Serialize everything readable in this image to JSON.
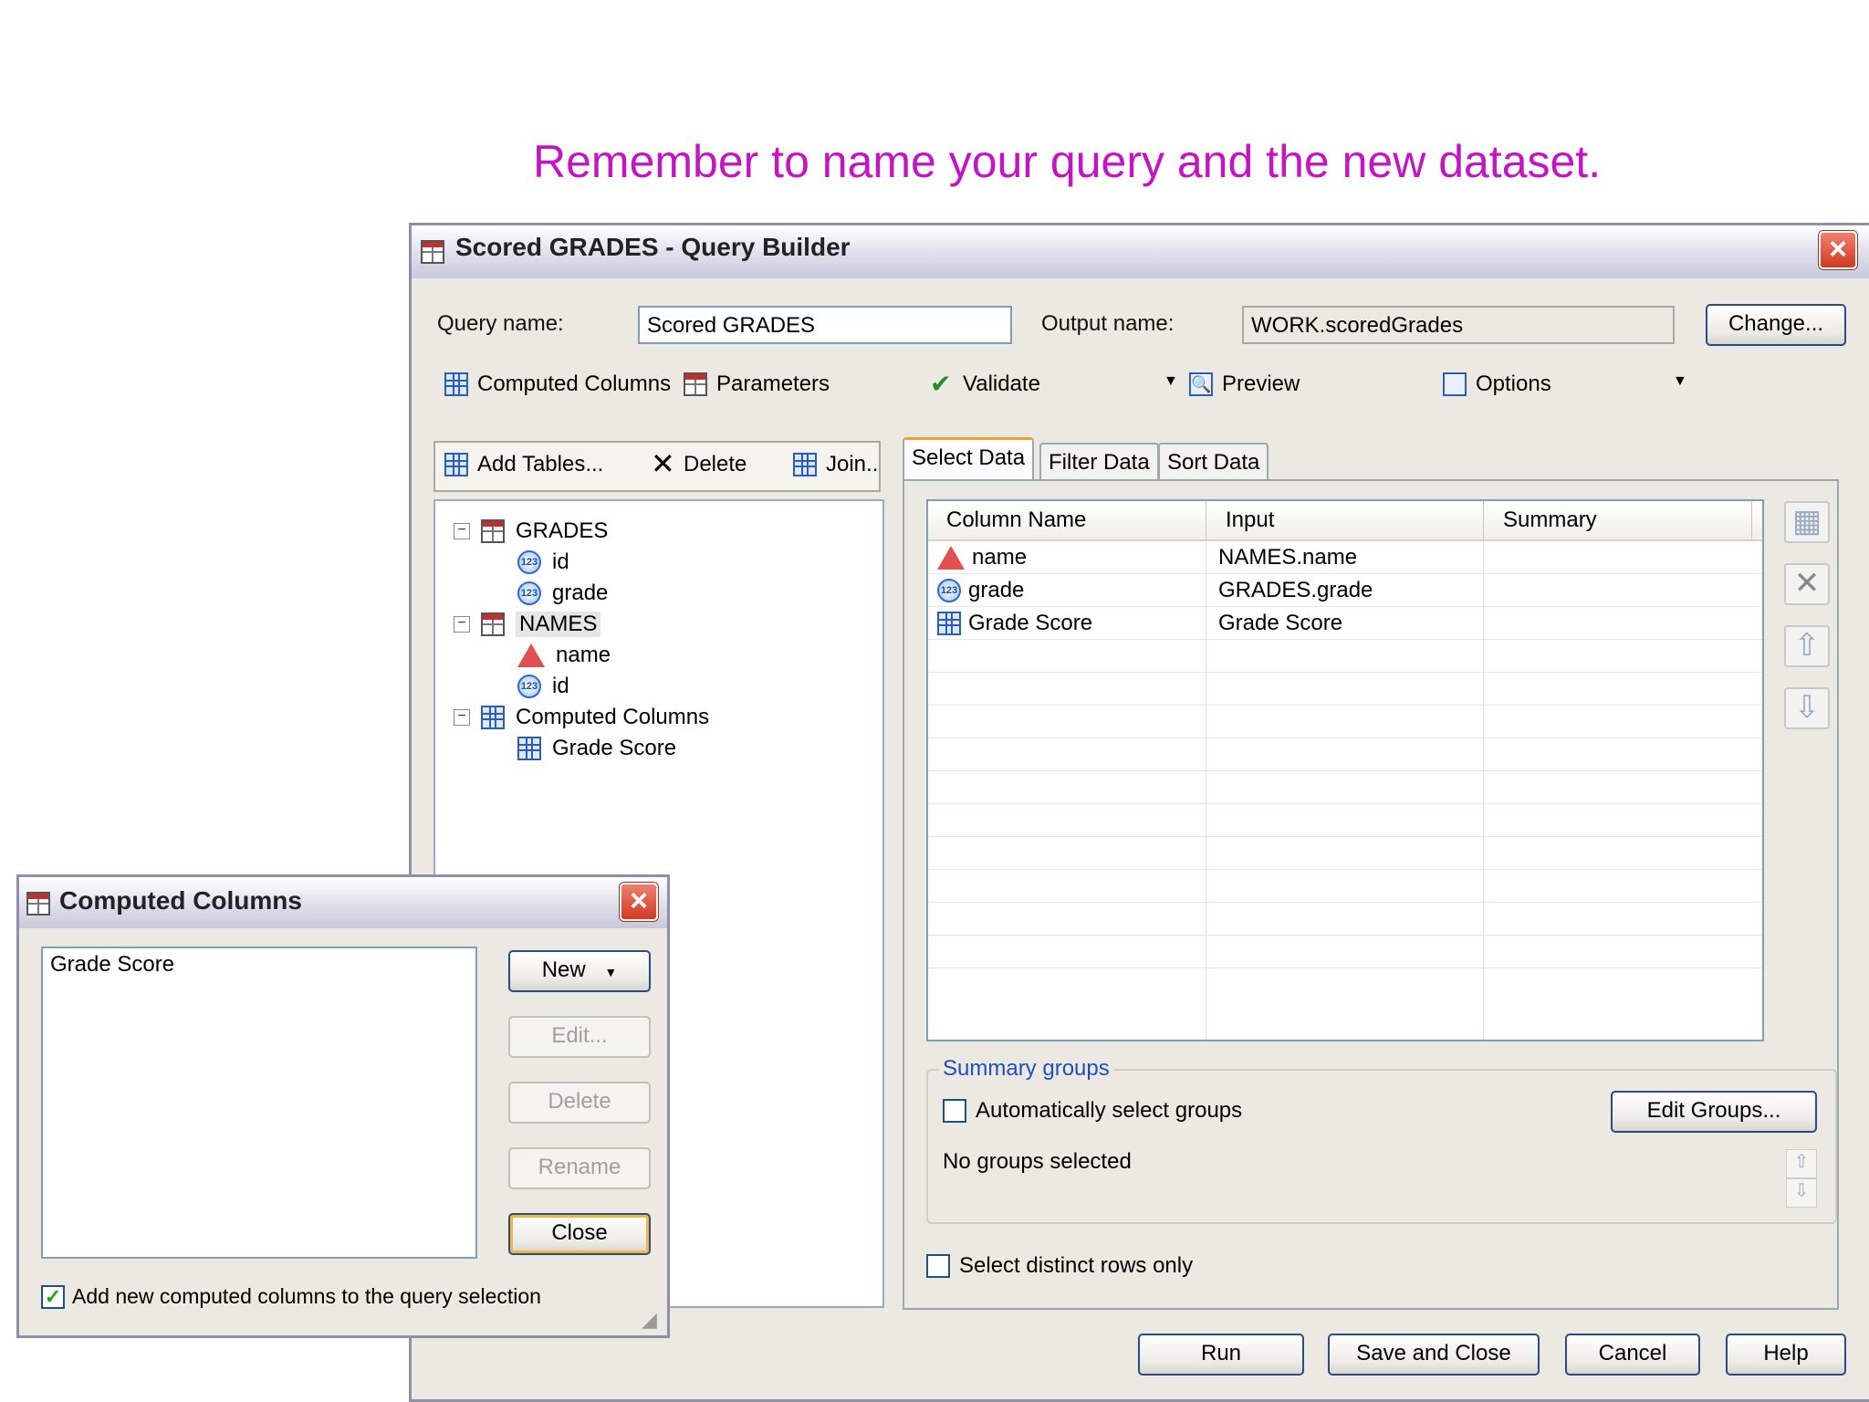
{
  "banner": "Remember to name your query and the new dataset.",
  "query_builder": {
    "title": "Scored GRADES - Query Builder",
    "query_name_label": "Query name:",
    "query_name_value": "Scored GRADES",
    "output_name_label": "Output name:",
    "output_name_value": "WORK.scoredGrades",
    "change_button": "Change...",
    "toolbar": {
      "computed_columns": "Computed Columns",
      "parameters": "Parameters",
      "validate": "Validate",
      "preview": "Preview",
      "options": "Options"
    },
    "tables_toolbar": {
      "add_tables": "Add Tables...",
      "delete": "Delete",
      "join": "Join.."
    },
    "tree": [
      {
        "label": "GRADES",
        "icon": "table-icon",
        "children": [
          {
            "label": "id",
            "icon": "numeric-icon"
          },
          {
            "label": "grade",
            "icon": "numeric-icon"
          }
        ]
      },
      {
        "label": "NAMES",
        "icon": "table-icon",
        "children": [
          {
            "label": "name",
            "icon": "character-icon"
          },
          {
            "label": "id",
            "icon": "numeric-icon"
          }
        ]
      },
      {
        "label": "Computed Columns",
        "icon": "computed-icon",
        "children": [
          {
            "label": "Grade Score",
            "icon": "computed-icon"
          }
        ]
      }
    ],
    "tabs": [
      "Select Data",
      "Filter Data",
      "Sort Data"
    ],
    "active_tab": "Select Data",
    "columns": [
      "Column Name",
      "Input",
      "Summary"
    ],
    "rows": [
      {
        "name": "name",
        "icon": "character-icon",
        "input": "NAMES.name",
        "summary": ""
      },
      {
        "name": "grade",
        "icon": "numeric-icon",
        "input": "GRADES.grade",
        "summary": ""
      },
      {
        "name": "Grade Score",
        "icon": "computed-icon",
        "input": "Grade Score",
        "summary": ""
      }
    ],
    "summary_groups": {
      "legend": "Summary groups",
      "auto_select_label": "Automatically select groups",
      "auto_select_checked": false,
      "edit_groups_button": "Edit Groups...",
      "status": "No groups selected"
    },
    "distinct_label": "Select distinct rows only",
    "distinct_checked": false,
    "buttons": {
      "run": "Run",
      "save_close": "Save and Close",
      "cancel": "Cancel",
      "help": "Help"
    }
  },
  "computed_columns_dialog": {
    "title": "Computed Columns",
    "list_items": [
      "Grade Score"
    ],
    "buttons": {
      "new": "New",
      "edit": "Edit...",
      "delete": "Delete",
      "rename": "Rename",
      "close": "Close"
    },
    "add_to_selection_label": "Add new computed columns to the query selection",
    "add_to_selection_checked": true
  }
}
